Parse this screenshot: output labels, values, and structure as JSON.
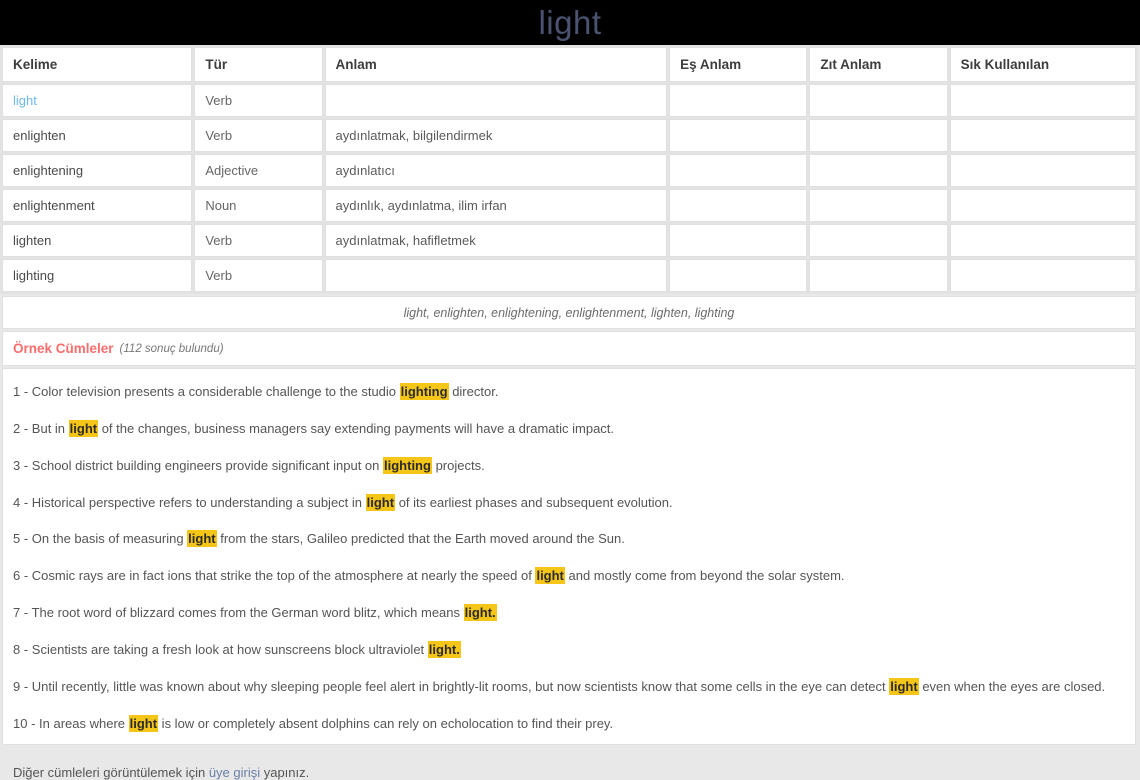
{
  "header": {
    "title": "light",
    "background_color": "#000000",
    "title_color": "#4b5370"
  },
  "table": {
    "columns": [
      "Kelime",
      "Tür",
      "Anlam",
      "Eş Anlam",
      "Zıt Anlam",
      "Sık Kullanılan"
    ],
    "rows": [
      {
        "kelime": "light",
        "tur": "Verb",
        "anlam": "",
        "es_anlam": "",
        "zit_anlam": "",
        "sik_kullanilan": "",
        "is_link": true
      },
      {
        "kelime": "enlighten",
        "tur": "Verb",
        "anlam": "aydınlatmak, bilgilendirmek",
        "es_anlam": "",
        "zit_anlam": "",
        "sik_kullanilan": "",
        "is_link": false
      },
      {
        "kelime": "enlightening",
        "tur": "Adjective",
        "anlam": "aydınlatıcı",
        "es_anlam": "",
        "zit_anlam": "",
        "sik_kullanilan": "",
        "is_link": false
      },
      {
        "kelime": "enlightenment",
        "tur": "Noun",
        "anlam": "aydınlık, aydınlatma, ilim irfan",
        "es_anlam": "",
        "zit_anlam": "",
        "sik_kullanilan": "",
        "is_link": false
      },
      {
        "kelime": "lighten",
        "tur": "Verb",
        "anlam": "aydınlatmak, hafifletmek",
        "es_anlam": "",
        "zit_anlam": "",
        "sik_kullanilan": "",
        "is_link": false
      },
      {
        "kelime": "lighting",
        "tur": "Verb",
        "anlam": "",
        "es_anlam": "",
        "zit_anlam": "",
        "sik_kullanilan": "",
        "is_link": false
      }
    ]
  },
  "forms_row": {
    "text": "light, enlighten, enlightening, enlightenment, lighten, lighting"
  },
  "examples": {
    "title": "Örnek Cümleler",
    "count_text": "(112 sonuç bulundu)",
    "title_color": "#fb6d6d",
    "highlight_color": "#f5c518",
    "sentences": [
      {
        "number": "1 - ",
        "before": "Color television presents a considerable challenge to the studio ",
        "highlight": "lighting",
        "after": " director."
      },
      {
        "number": "2 - ",
        "before": "But in ",
        "highlight": "light",
        "after": " of the changes, business managers say extending payments will have a dramatic impact."
      },
      {
        "number": "3 - ",
        "before": "School district building engineers provide significant input on ",
        "highlight": "lighting",
        "after": " projects."
      },
      {
        "number": "4 - ",
        "before": "Historical perspective refers to understanding a subject in ",
        "highlight": "light",
        "after": " of its earliest phases and subsequent evolution."
      },
      {
        "number": "5 - ",
        "before": "On the basis of measuring ",
        "highlight": "light",
        "after": " from the stars, Galileo predicted that the Earth moved around the Sun."
      },
      {
        "number": "6 - ",
        "before": "Cosmic rays are in fact ions that strike the top of the atmosphere at nearly the speed of ",
        "highlight": "light",
        "after": " and mostly come from beyond the solar system."
      },
      {
        "number": "7 - ",
        "before": "The root word of blizzard comes from the German word blitz, which means ",
        "highlight": "light.",
        "after": ""
      },
      {
        "number": "8 - ",
        "before": "Scientists are taking a fresh look at how sunscreens block ultraviolet ",
        "highlight": "light.",
        "after": ""
      },
      {
        "number": "9 - ",
        "before": "Until recently, little was known about why sleeping people feel alert in brightly-lit rooms, but now scientists know that some cells in the eye can detect ",
        "highlight": "light",
        "after": " even when the eyes are closed."
      },
      {
        "number": "10 - ",
        "before": "In areas where ",
        "highlight": "light",
        "after": " is low or completely absent dolphins can rely on echolocation to find their prey."
      }
    ],
    "login_note": {
      "before": "Diğer cümleleri görüntülemek için ",
      "link": "üye girişi",
      "after": " yapınız."
    }
  }
}
